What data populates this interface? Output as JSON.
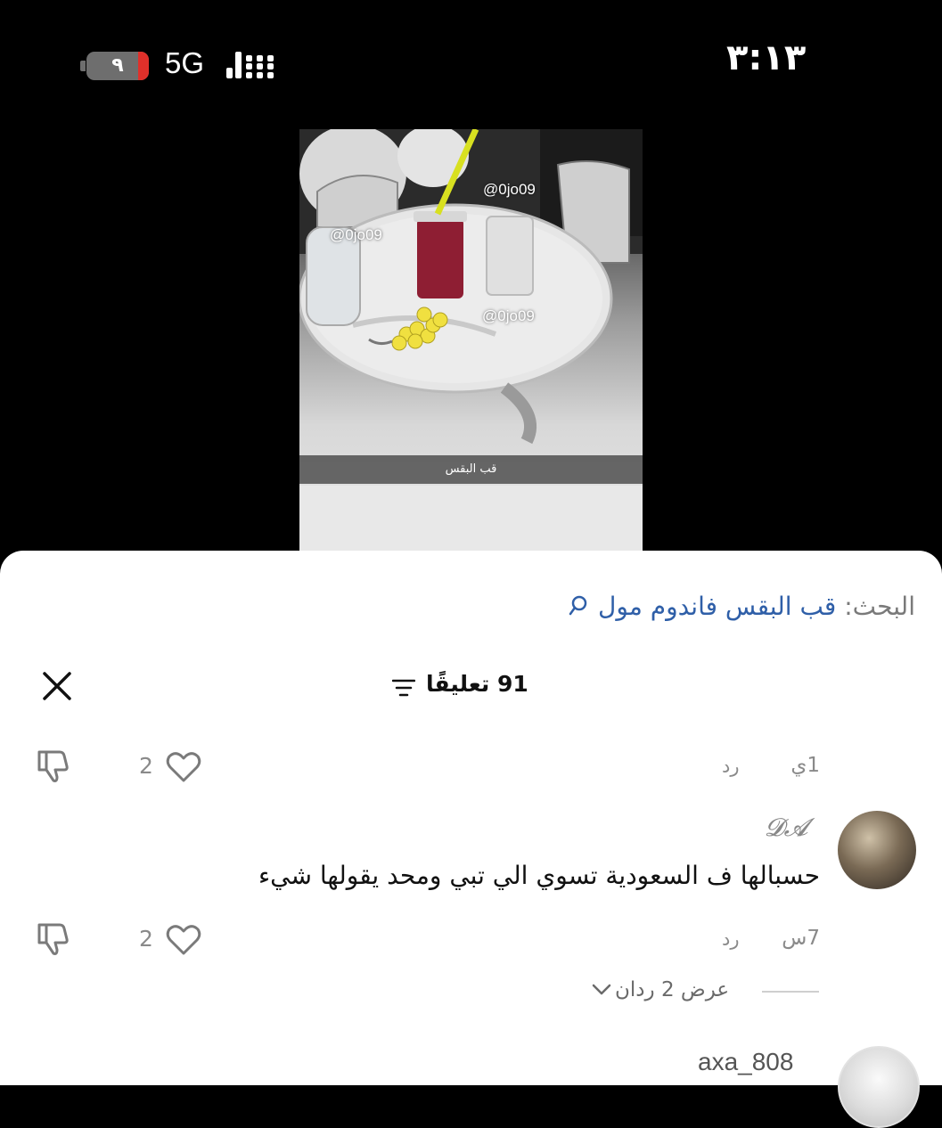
{
  "status_bar": {
    "time": "٣:١٣",
    "battery_level": "٩",
    "network": "5G"
  },
  "video": {
    "watermark": "@0jo09",
    "caption": "قب البقس"
  },
  "search": {
    "label": "البحث:",
    "query": "قب البقس فاندوم مول"
  },
  "comments_header": {
    "title": "91 تعليقًا"
  },
  "top_meta": {
    "time": "1ي",
    "reply_label": "رد",
    "likes": "2"
  },
  "comment": {
    "user": "𝓓𝓐",
    "text": "حسبالها ف السعودية تسوي الي تبي ومحد يقولها شيء",
    "time": "7س",
    "reply_label": "رد",
    "likes": "2",
    "view_replies": "عرض 2 ردان"
  },
  "next_comment": {
    "user": "axa_808"
  },
  "colors": {
    "accent_link": "#2f5fa8",
    "battery_low": "#e0302a",
    "muted_text": "#8a8a8a"
  }
}
